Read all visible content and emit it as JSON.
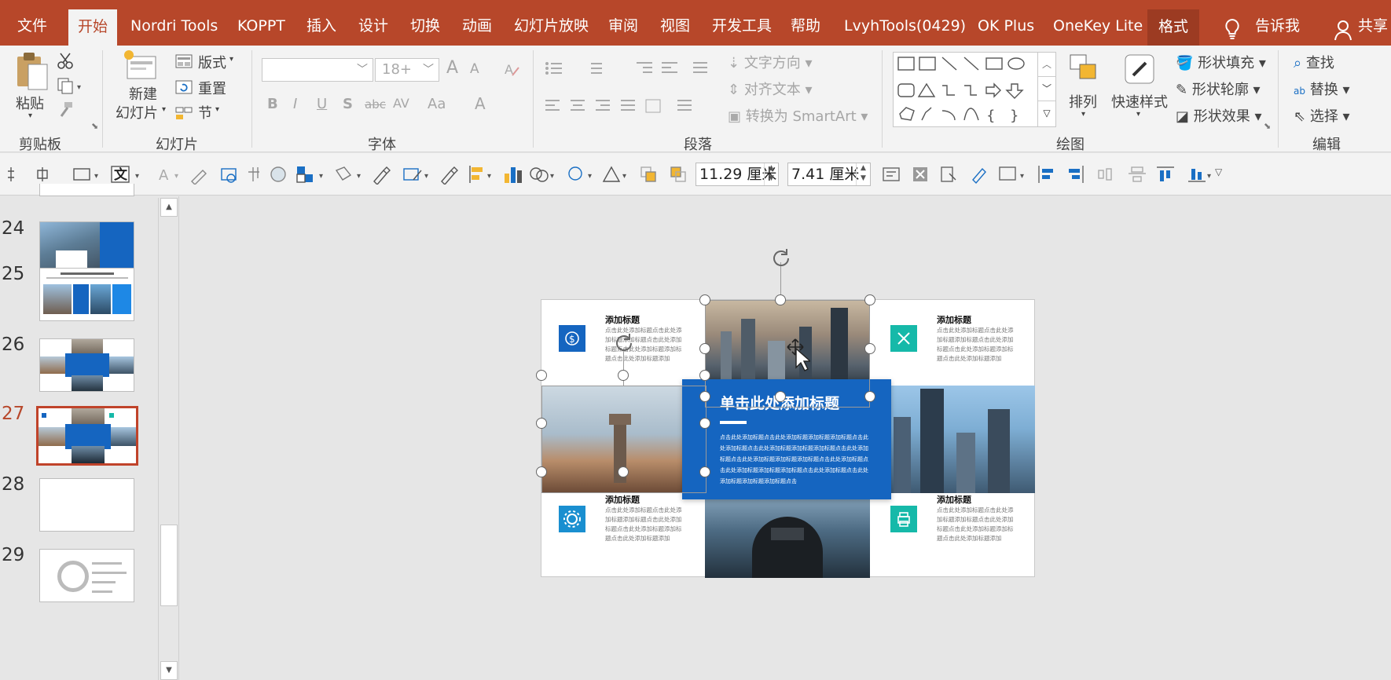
{
  "menubar": {
    "tabs": [
      "文件",
      "开始",
      "Nordri Tools",
      "KOPPT",
      "插入",
      "设计",
      "切换",
      "动画",
      "幻灯片放映",
      "审阅",
      "视图",
      "开发工具",
      "帮助",
      "LvyhTools(0429)",
      "OK Plus",
      "OneKey Lite",
      "格式"
    ],
    "active_tab": "开始",
    "tell_me": "告诉我",
    "share": "共享",
    "accent_color": "#b7472a"
  },
  "ribbon": {
    "clipboard": {
      "paste": "粘贴",
      "group": "剪贴板"
    },
    "slides": {
      "new_slide_line1": "新建",
      "new_slide_line2": "幻灯片",
      "layout": "版式",
      "reset": "重置",
      "section": "节",
      "group": "幻灯片"
    },
    "font": {
      "font_name": "",
      "font_size": "18+",
      "bold": "B",
      "italic": "I",
      "underline": "U",
      "shadow": "S",
      "strike": "abc",
      "spacing": "AV",
      "case": "Aa",
      "color": "A",
      "grow": "A",
      "shrink": "A",
      "group": "字体"
    },
    "paragraph": {
      "text_direction": "文字方向",
      "align_text": "对齐文本",
      "smartart": "转换为 SmartArt",
      "group": "段落"
    },
    "drawing": {
      "arrange": "排列",
      "quick_styles": "快速样式",
      "shape_fill": "形状填充",
      "shape_outline": "形状轮廓",
      "shape_effects": "形状效果",
      "group": "绘图"
    },
    "editing": {
      "find": "查找",
      "replace": "替换",
      "select": "选择",
      "group": "编辑"
    }
  },
  "format_toolbar": {
    "width_value": "11.29 厘米",
    "height_value": "7.41 厘米"
  },
  "thumbnails": {
    "numbers": [
      "24",
      "25",
      "26",
      "27",
      "28",
      "29"
    ],
    "active": "27"
  },
  "slide": {
    "cards": [
      {
        "title": "添加标题",
        "body": "点击此处添加标题点击此处添加标题添加标题点击此处添加标题点击此处添加标题添加标题点击此处添加标题添加",
        "icon": "money-icon",
        "color": "#1565c0"
      },
      {
        "title": "添加标题",
        "body": "点击此处添加标题点击此处添加标题添加标题点击此处添加标题点击此处添加标题添加标题点击此处添加标题添加",
        "icon": "tools-icon",
        "color": "#16b9a9"
      },
      {
        "title": "添加标题",
        "body": "点击此处添加标题点击此处添加标题添加标题点击此处添加标题点击此处添加标题添加标题点击此处添加标题添加",
        "icon": "gear-icon",
        "color": "#1a8fd0"
      },
      {
        "title": "添加标题",
        "body": "点击此处添加标题点击此处添加标题添加标题点击此处添加标题点击此处添加标题添加标题点击此处添加标题添加",
        "icon": "printer-icon",
        "color": "#16b9a9"
      }
    ],
    "center": {
      "title": "单击此处添加标题",
      "body": "点击此处添加标题点击此处添加标题添加标题添加标题点击此处添加标题点击此处添加标题添加标题添加标题点击此处添加标题点击此处添加标题添加标题添加标题点击此处添加标题点击此处添加标题添加标题添加标题点击此处添加标题点击此处添加标题添加标题添加标题点击",
      "color": "#1565c0"
    }
  }
}
